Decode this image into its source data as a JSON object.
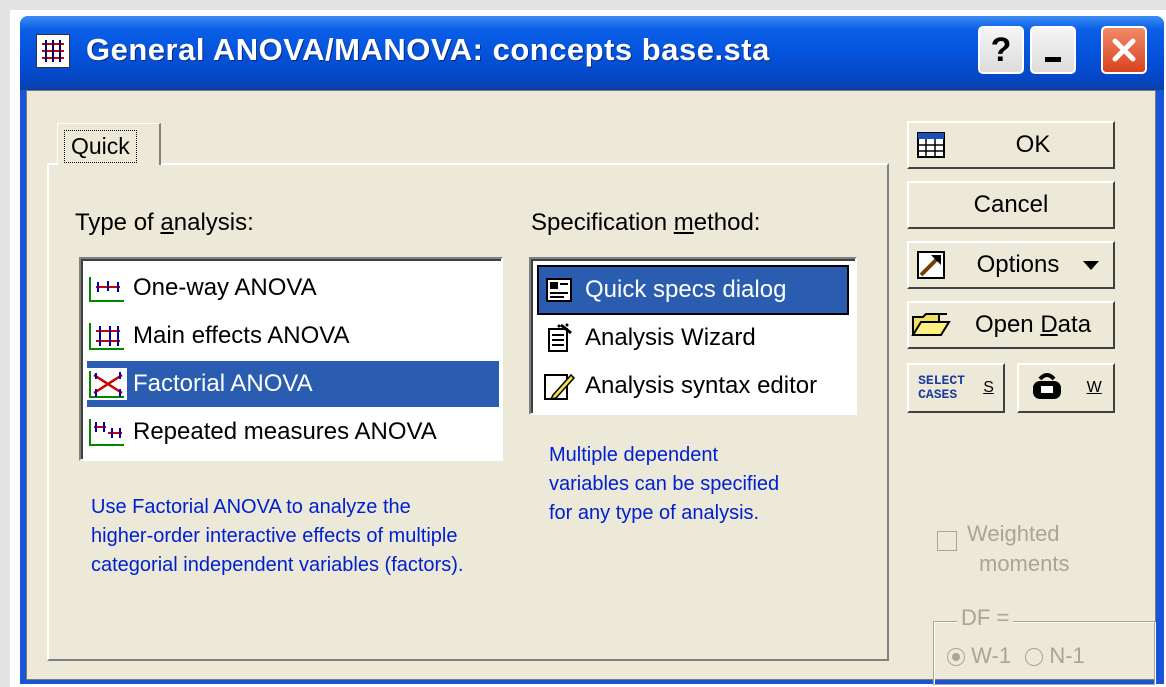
{
  "window": {
    "title": "General ANOVA/MANOVA: concepts base.sta",
    "help_label": "?",
    "min_label": "_",
    "close_label": "✕"
  },
  "tabs": [
    {
      "label": "Quick"
    }
  ],
  "analysis": {
    "label_pre": "Type of ",
    "label_ul": "a",
    "label_post": "nalysis:",
    "items": [
      {
        "label": "One-way ANOVA",
        "icon": "oneway-anova-icon"
      },
      {
        "label": "Main effects ANOVA",
        "icon": "main-effects-icon"
      },
      {
        "label": "Factorial ANOVA",
        "icon": "factorial-anova-icon",
        "selected": true
      },
      {
        "label": "Repeated measures ANOVA",
        "icon": "repeated-measures-icon"
      }
    ],
    "note_lines": [
      "Use Factorial ANOVA to analyze the",
      "higher-order interactive effects of multiple",
      "categorial independent variables (factors)."
    ]
  },
  "specification": {
    "label_pre": "Specification ",
    "label_ul": "m",
    "label_post": "ethod:",
    "items": [
      {
        "label": "Quick specs dialog",
        "icon": "quick-specs-icon",
        "selected": true
      },
      {
        "label": "Analysis Wizard",
        "icon": "wizard-icon"
      },
      {
        "label": "Analysis syntax editor",
        "icon": "syntax-editor-icon"
      }
    ],
    "note_lines": [
      "Multiple dependent",
      "variables can be specified",
      "for any type of analysis."
    ]
  },
  "buttons": {
    "ok": "OK",
    "cancel": "Cancel",
    "options": "Options",
    "open_data_pre": "Open ",
    "open_data_ul": "D",
    "open_data_post": "ata",
    "select_cases_line1": "SELECT",
    "select_cases_line2": "CASES",
    "select_cases_key": "S",
    "weight_key": "W"
  },
  "weighted": {
    "label_line1": "Weighted",
    "label_line2": "moments",
    "checked": false
  },
  "df_group": {
    "legend": "DF =",
    "options": [
      {
        "label": "W-1",
        "selected": true
      },
      {
        "label": "N-1",
        "selected": false
      }
    ]
  },
  "colors": {
    "titlebar": "#0453dc",
    "selection": "#2a5db0",
    "note_text": "#0020d0",
    "dialog_bg": "#ece9d8"
  }
}
